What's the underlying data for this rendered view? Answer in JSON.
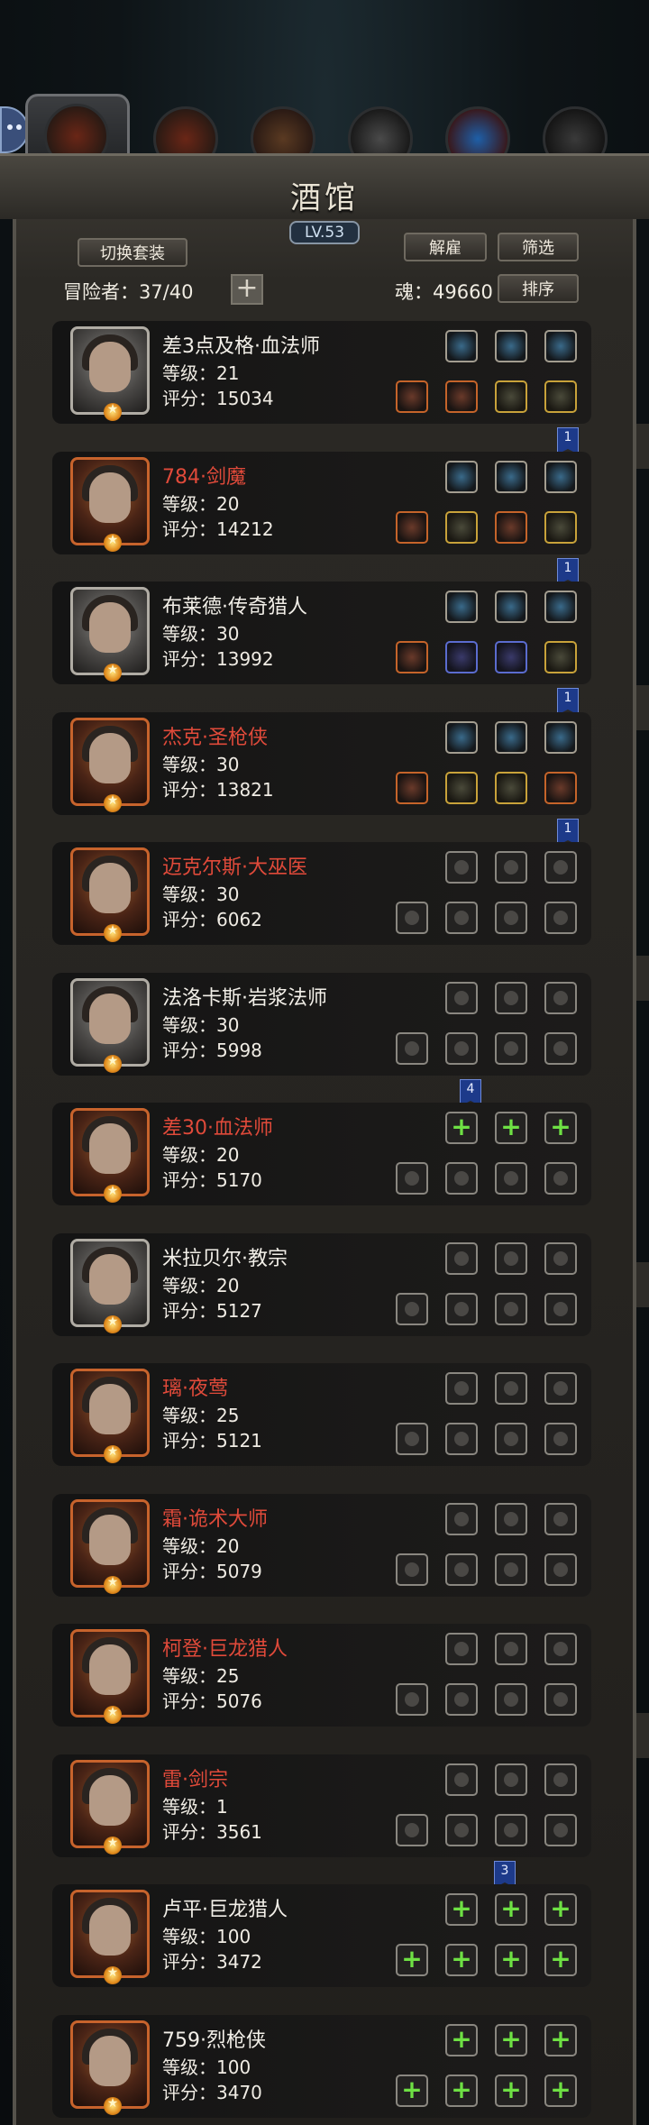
{
  "tavern": {
    "title": "酒馆",
    "level": "LV.53",
    "switch_outfit_label": "切换套装",
    "dismiss_label": "解雇",
    "filter_label": "筛选",
    "sort_label": "排序",
    "adventurers_text": "冒险者：37/40",
    "soul_text": "魂：49660",
    "add_symbol": "+"
  },
  "tabs": [
    "tab-1",
    "tab-2",
    "tab-3",
    "tab-4",
    "tab-5",
    "tab-6"
  ],
  "heroes": [
    {
      "name": "差3点及格·血法师",
      "name_color": "white",
      "level": "等级：21",
      "score": "评分：15034",
      "badge": "1"
    },
    {
      "name": "784·剑魔",
      "name_color": "red",
      "level": "等级：20",
      "score": "评分：14212",
      "badge": "1"
    },
    {
      "name": "布莱德·传奇猎人",
      "name_color": "white",
      "level": "等级：30",
      "score": "评分：13992",
      "badge": "1"
    },
    {
      "name": "杰克·圣枪侠",
      "name_color": "red",
      "level": "等级：30",
      "score": "评分：13821",
      "badge": "1"
    },
    {
      "name": "迈克尔斯·大巫医",
      "name_color": "red",
      "level": "等级：30",
      "score": "评分：6062",
      "badge": ""
    },
    {
      "name": "法洛卡斯·岩浆法师",
      "name_color": "white",
      "level": "等级：30",
      "score": "评分：5998",
      "badge": "4"
    },
    {
      "name": "差30·血法师",
      "name_color": "red",
      "level": "等级：20",
      "score": "评分：5170",
      "badge": ""
    },
    {
      "name": "米拉贝尔·教宗",
      "name_color": "white",
      "level": "等级：20",
      "score": "评分：5127",
      "badge": ""
    },
    {
      "name": "璃·夜莺",
      "name_color": "red",
      "level": "等级：25",
      "score": "评分：5121",
      "badge": ""
    },
    {
      "name": "霜·诡术大师",
      "name_color": "red",
      "level": "等级：20",
      "score": "评分：5079",
      "badge": ""
    },
    {
      "name": "柯登·巨龙猎人",
      "name_color": "red",
      "level": "等级：25",
      "score": "评分：5076",
      "badge": ""
    },
    {
      "name": "雷·剑宗",
      "name_color": "red",
      "level": "等级：1",
      "score": "评分：3561",
      "badge": "3"
    },
    {
      "name": "卢平·巨龙猎人",
      "name_color": "white",
      "level": "等级：100",
      "score": "评分：3472",
      "badge": ""
    },
    {
      "name": "759·烈枪侠",
      "name_color": "white",
      "level": "等级：100",
      "score": "评分：3470",
      "badge": ""
    }
  ],
  "colors": {
    "accent_red": "#e04a3a",
    "plus_green": "#6ee044",
    "badge_blue": "#1d3a8a"
  }
}
